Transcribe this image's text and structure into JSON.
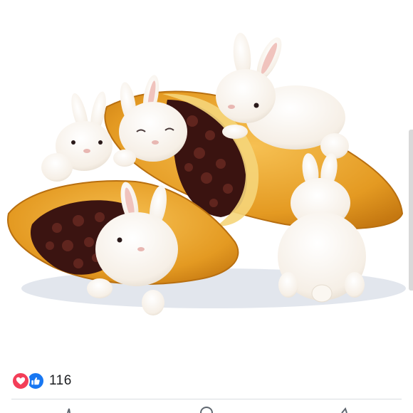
{
  "post": {
    "image_description_icon": "bunnies-in-pastries-illustration"
  },
  "reactions": {
    "icons": [
      "love-reaction-icon",
      "like-reaction-icon"
    ],
    "count": "116",
    "colors": {
      "love": "#f33e58",
      "like": "#1877f2"
    }
  },
  "actions": {
    "icons": [
      "like-action-icon",
      "comment-action-icon",
      "share-action-icon"
    ]
  }
}
